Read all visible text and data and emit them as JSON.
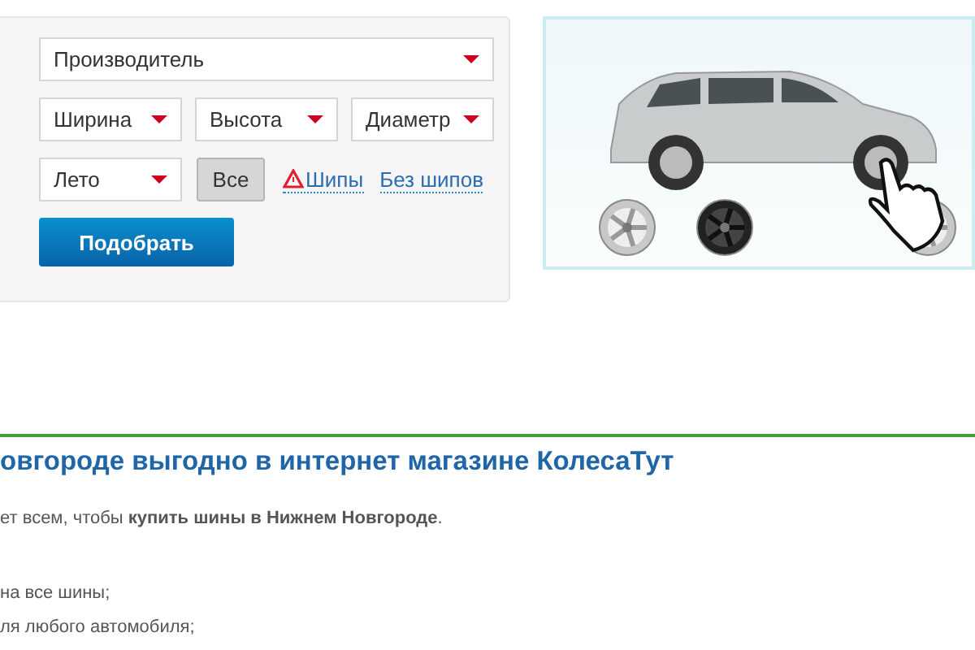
{
  "filter": {
    "manufacturer": {
      "placeholder": "Производитель"
    },
    "sizes": [
      {
        "placeholder": "Ширина"
      },
      {
        "placeholder": "Высота"
      },
      {
        "placeholder": "Диаметр"
      }
    ],
    "season": {
      "value": "Лето"
    },
    "studs": [
      {
        "label": "Все",
        "kind": "button",
        "selected": true
      },
      {
        "label": "Шипы",
        "kind": "warning-link",
        "selected": false
      },
      {
        "label": "Без шипов",
        "kind": "link",
        "selected": false
      }
    ],
    "submit": "Подобрать"
  },
  "article": {
    "heading": "овгороде выгодно в интернет магазине КолесаТут",
    "intro": "ет всем, чтобы **купить шины в Нижнем Новгороде**.",
    "list": [
      "на все шины;",
      "ля любого автомобиля;"
    ]
  }
}
